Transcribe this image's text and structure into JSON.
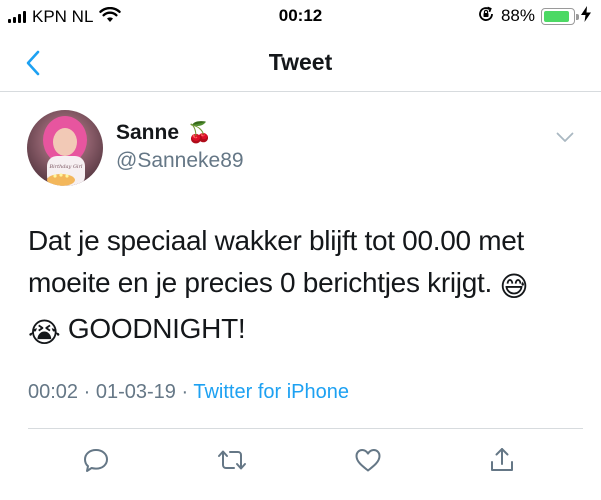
{
  "status_bar": {
    "carrier": "KPN NL",
    "time": "00:12",
    "battery_percent": "88%",
    "battery_level": 0.88,
    "icons": [
      "signal-icon",
      "wifi-icon",
      "orientation-lock-icon",
      "battery-icon",
      "charging-bolt-icon"
    ]
  },
  "nav": {
    "title": "Tweet",
    "back_icon": "chevron-left-icon"
  },
  "tweet": {
    "author_name": "Sanne",
    "author_emoji": "🍒",
    "handle": "@Sanneke89",
    "text_line1": "Dat je speciaal wakker blijft tot 00.00 met",
    "text_line2": "moeite en je precies 0 berichtjes krijgt.",
    "text_line2_emoji": "😅",
    "text_line3_emoji": "😭",
    "text_line3": "GOODNIGHT!",
    "time": "00:02",
    "date": "01-03-19",
    "separator": "·",
    "source": "Twitter for iPhone"
  },
  "actions": [
    "reply-icon",
    "retweet-icon",
    "like-icon",
    "share-icon"
  ],
  "colors": {
    "accent": "#1da1f2",
    "text": "#14171a",
    "muted": "#657786",
    "icon": "#657786",
    "battery": "#4cd964"
  }
}
